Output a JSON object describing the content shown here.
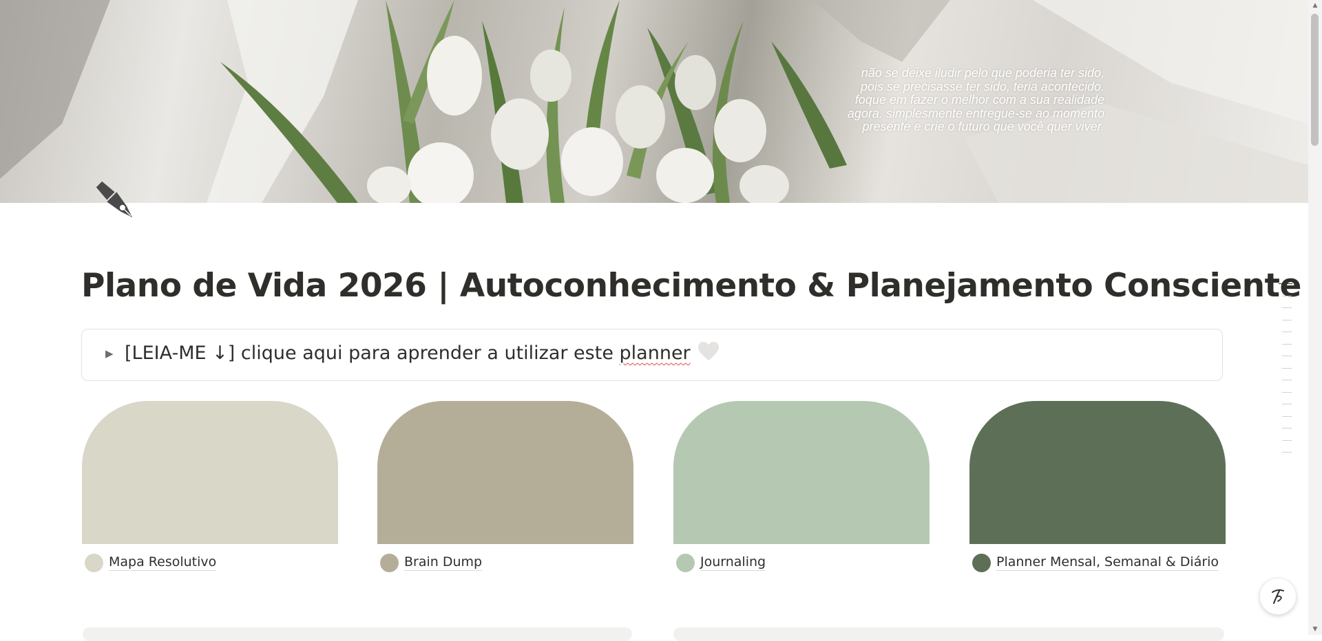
{
  "cover": {
    "quote_lines": [
      "não se deixe iludir pelo que poderia ter sido,",
      "pois se precisasse ter sido, teria acontecido.",
      "foque em fazer o melhor com a sua realidade",
      "agora. simplesmente entregue-se ao momento",
      "presente e crie o futuro que você quer viver."
    ]
  },
  "page": {
    "icon": "fountain-pen-icon",
    "title": "Plano de Vida 2026 | Autoconhecimento & Planejamento Consciente"
  },
  "callout": {
    "text_prefix": "[LEIA-ME ↓] clique aqui para aprender a utilizar este ",
    "text_underlined": "planner",
    "icon": "heart-icon"
  },
  "cards": [
    {
      "label": "Mapa Resolutivo",
      "color": "#d8d7c8"
    },
    {
      "label": "Brain Dump",
      "color": "#b4ad98"
    },
    {
      "label": "Journaling",
      "color": "#b5c9b2"
    },
    {
      "label": "Planner Mensal, Semanal & Diário",
      "color": "#5d7057"
    }
  ],
  "help": {
    "icon": "help-icon"
  }
}
